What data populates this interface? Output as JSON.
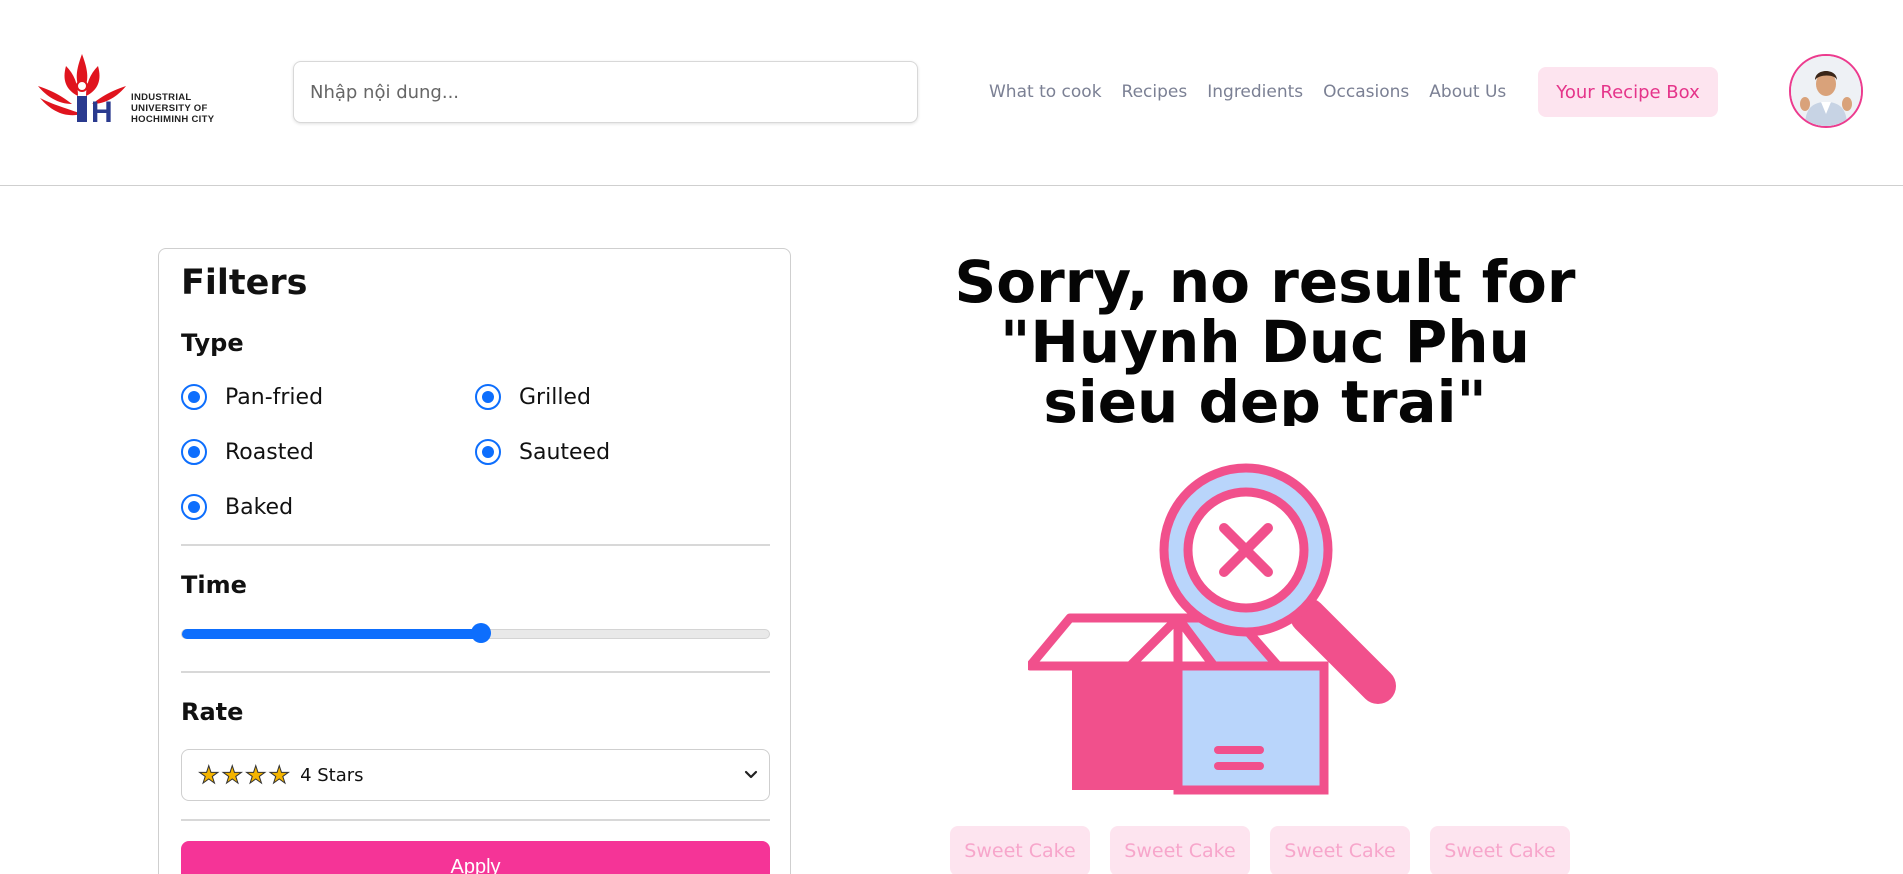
{
  "logo": {
    "line1": "INDUSTRIAL",
    "line2": "UNIVERSITY OF",
    "line3": "HOCHIMINH CITY"
  },
  "search": {
    "placeholder": "Nhập nội dung..."
  },
  "nav": {
    "items": [
      "What to cook",
      "Recipes",
      "Ingredients",
      "Occasions",
      "About Us"
    ]
  },
  "header": {
    "recipe_box_label": "Your Recipe Box"
  },
  "filters": {
    "title": "Filters",
    "type_title": "Type",
    "types": [
      "Pan-fried",
      "Grilled",
      "Roasted",
      "Sauteed",
      "Baked"
    ],
    "time_title": "Time",
    "time_level_percent": 51,
    "rate_title": "Rate",
    "rate_stars": "★★★★",
    "rate_value": "4 Stars",
    "apply_label": "Apply"
  },
  "result": {
    "message": "Sorry, no result for \"Huynh Duc Phu sieu dep trai\""
  },
  "chips": [
    "Sweet Cake",
    "Sweet Cake",
    "Sweet Cake",
    "Sweet Cake"
  ],
  "colors": {
    "accent": "#f53497",
    "accent_light": "#fde4ef",
    "radio_blue": "#0d6efd",
    "illustration_pink": "#f1508c",
    "illustration_blue": "#b9d5fb"
  }
}
